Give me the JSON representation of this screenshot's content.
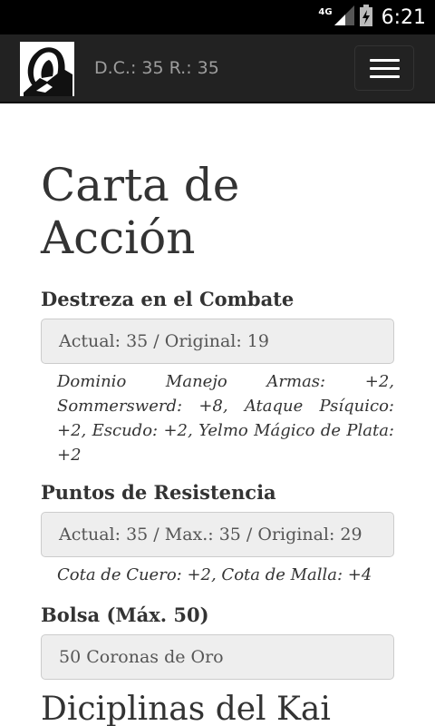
{
  "statusbar": {
    "network": "4G",
    "time": "6:21"
  },
  "navbar": {
    "stats": "D.C.: 35 R.: 35"
  },
  "page": {
    "title": "Carta de Acción"
  },
  "combat": {
    "heading": "Destreza en el Combate",
    "value": "Actual: 35 / Original: 19",
    "bonuses": "Dominio Manejo Armas: +2, Sommerswerd: +8, Ataque Psíquico: +2, Escudo: +2, Yelmo Mágico de Plata: +2"
  },
  "endurance": {
    "heading": "Puntos de Resistencia",
    "value": "Actual: 35 / Max.: 35 / Original: 29",
    "bonuses": "Cota de Cuero: +2, Cota de Malla: +4"
  },
  "pouch": {
    "heading": "Bolsa (Máx. 50)",
    "value": "50 Coronas de Oro"
  },
  "kai": {
    "heading": "Diciplinas del Kai"
  }
}
